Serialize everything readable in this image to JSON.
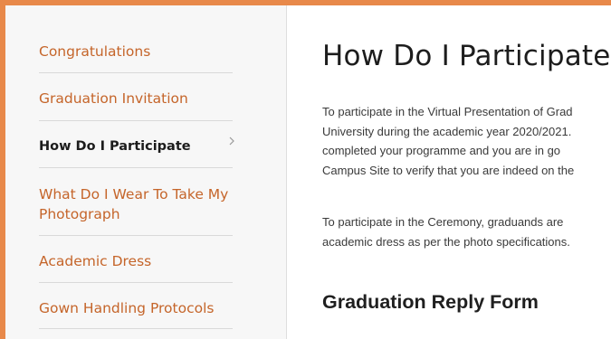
{
  "sidebar": {
    "items": [
      {
        "label": "Congratulations",
        "active": false
      },
      {
        "label": "Graduation Invitation",
        "active": false
      },
      {
        "label": "How Do I Participate",
        "active": true
      },
      {
        "label": "What Do I Wear To Take My Photograph",
        "line1": "What Do I Wear To Take My",
        "line2": "Photograph",
        "active": false
      },
      {
        "label": "Academic Dress",
        "active": false
      },
      {
        "label": "Gown Handling Protocols",
        "active": false
      }
    ]
  },
  "main": {
    "title": "How Do I Participate",
    "paragraph1": {
      "lines": [
        "To participate in the Virtual Presentation of Grad",
        "University during the academic year 2020/2021.",
        "completed your programme and you are in go",
        "Campus Site to verify that you are indeed on the"
      ]
    },
    "paragraph2": {
      "lines": [
        "To participate in the Ceremony, graduands are",
        "academic dress as per the photo specifications."
      ]
    },
    "subheading": "Graduation Reply Form"
  },
  "colors": {
    "accent": "#e8894a",
    "link": "#c5652a",
    "active_text": "#1c1c1c"
  },
  "icons": {
    "active_indicator": "chevron-right-icon"
  }
}
